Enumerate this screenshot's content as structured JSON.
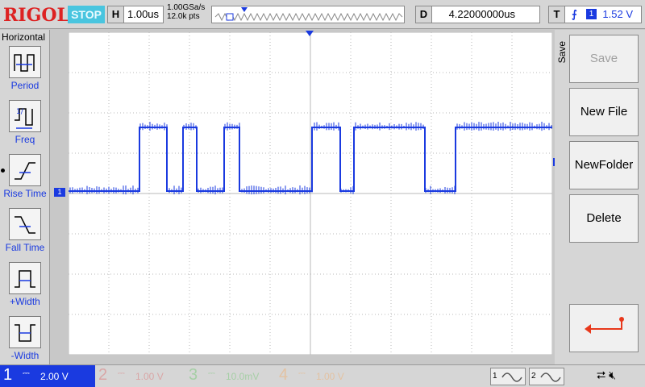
{
  "brand": "RIGOL",
  "status": "STOP",
  "timebase": {
    "tag": "H",
    "value": "1.00us"
  },
  "acquisition": {
    "sample_rate": "1.00GSa/s",
    "memory_depth": "12.0k pts"
  },
  "delay": {
    "tag": "D",
    "value": "4.22000000us"
  },
  "trigger": {
    "tag": "T",
    "slope": "rising-edge-icon",
    "source": "1",
    "level": "1.52 V"
  },
  "left_menu": {
    "title": "Horizontal",
    "items": [
      {
        "label": "Period",
        "icon": "period-icon"
      },
      {
        "label": "Freq",
        "icon": "frequency-icon"
      },
      {
        "label": "Rise Time",
        "icon": "rise-time-icon"
      },
      {
        "label": "Fall Time",
        "icon": "fall-time-icon"
      },
      {
        "label": "+Width",
        "icon": "positive-width-icon"
      },
      {
        "label": "-Width",
        "icon": "negative-width-icon"
      }
    ]
  },
  "right_menu": {
    "title": "Save",
    "buttons": [
      {
        "label": "Save",
        "enabled": false
      },
      {
        "label": "New File",
        "enabled": true
      },
      {
        "label": "NewFolder",
        "enabled": true
      },
      {
        "label": "Delete",
        "enabled": true
      },
      {
        "label": "",
        "icon": "return-icon"
      }
    ]
  },
  "channels": [
    {
      "num": "1",
      "coupling": "DC",
      "scale": "2.00 V",
      "active": true,
      "color": "#1a3ae0"
    },
    {
      "num": "2",
      "coupling": "DC",
      "scale": "1.00 V",
      "active": false,
      "color": "#d9a6a6"
    },
    {
      "num": "3",
      "coupling": "DC",
      "scale": "10.0mV",
      "active": false,
      "color": "#a6cfa6"
    },
    {
      "num": "4",
      "coupling": "DC",
      "scale": "1.00 V",
      "active": false,
      "color": "#e3c2a2"
    }
  ],
  "math": [
    "1",
    "2"
  ],
  "ch1_marker": "1",
  "trace_color": "#1a3ae0",
  "waveform": {
    "levels": [
      "low",
      "high",
      "low",
      "high",
      "low",
      "high",
      "low",
      "high",
      "low",
      "high",
      "low",
      "high"
    ],
    "grid_divisions": {
      "x": 12,
      "y": 8
    }
  }
}
